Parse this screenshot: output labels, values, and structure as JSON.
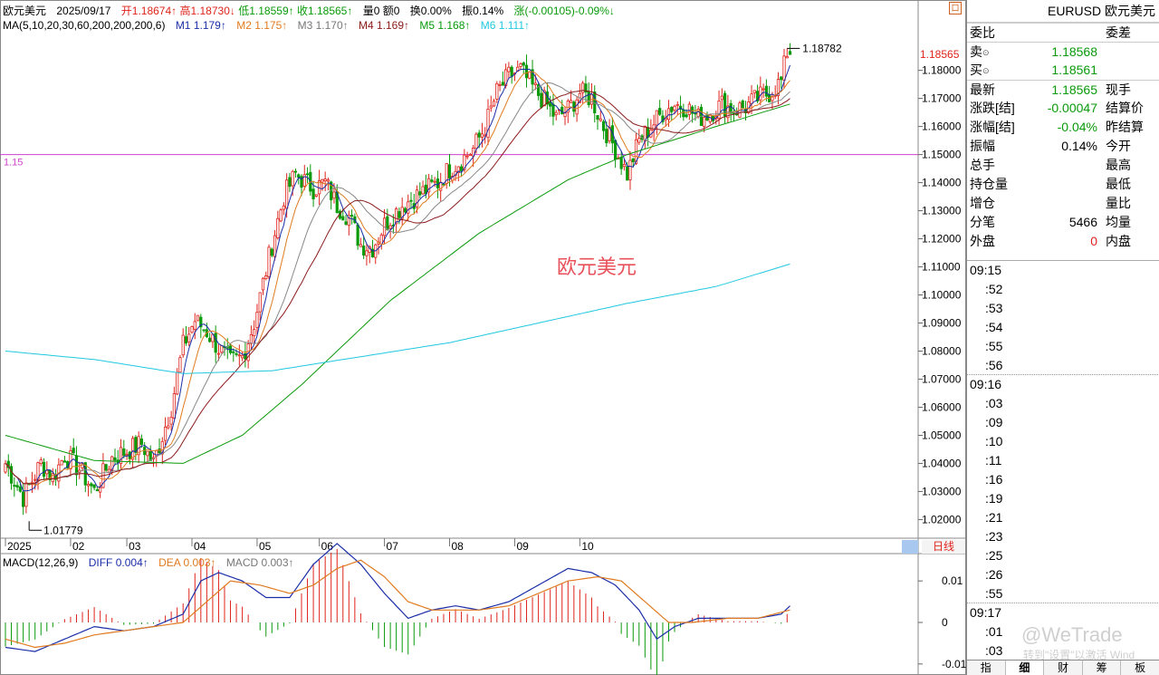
{
  "header": {
    "name": "欧元美元",
    "date": "2025/09/17",
    "open": "开1.18674↑",
    "high": "高1.18730↓",
    "low": "低1.18559↑",
    "close": "收1.18565↑",
    "volume": "量0",
    "amount": "额0",
    "turnover": "换0.00%",
    "amplitude": "振0.14%",
    "change": "涨(-0.00105)-0.09%↓"
  },
  "ma_legend": {
    "title": "MA(5,10,20,30,60,200,200,200,6)",
    "items": [
      {
        "text": "M1 1.179↑",
        "color": "#1a2ea8"
      },
      {
        "text": "M2 1.175↑",
        "color": "#e07b20"
      },
      {
        "text": "M3 1.170↑",
        "color": "#888888"
      },
      {
        "text": "M4 1.169↑",
        "color": "#8b1a1a"
      },
      {
        "text": "M5 1.168↑",
        "color": "#0a9a0a"
      },
      {
        "text": "M6 1.111↑",
        "color": "#20c8e0"
      }
    ]
  },
  "macd_legend": {
    "title": "MACD(12,26,9)",
    "diff": "DIFF 0.004↑",
    "dea": "DEA 0.003↑",
    "macd": "MACD 0.003↑"
  },
  "chart_data": {
    "type": "candlestick",
    "price_axis": {
      "range": [
        1.014,
        1.1915
      ],
      "ticks": [
        "1.18000",
        "1.17000",
        "1.16000",
        "1.15000",
        "1.14000",
        "1.13000",
        "1.12000",
        "1.11000",
        "1.10000",
        "1.09000",
        "1.08000",
        "1.07000",
        "1.06000",
        "1.05000",
        "1.04000",
        "1.03000",
        "1.02000"
      ],
      "current_price": "1.18565"
    },
    "time_axis": [
      "2025",
      "02",
      "03",
      "04",
      "05",
      "06",
      "07",
      "08",
      "09",
      "10"
    ],
    "annotations": {
      "high": "1.18782",
      "low": "1.01779",
      "hline_value": 1.15,
      "hline_label": "1.15",
      "watermark_label": "欧元美元"
    },
    "candle_anchors": [
      [
        0,
        1.04
      ],
      [
        6,
        1.028
      ],
      [
        12,
        1.04
      ],
      [
        16,
        1.035
      ],
      [
        20,
        1.043
      ],
      [
        25,
        1.038
      ],
      [
        30,
        1.03
      ],
      [
        36,
        1.042
      ],
      [
        42,
        1.045
      ],
      [
        46,
        1.047
      ],
      [
        50,
        1.04
      ],
      [
        56,
        1.06
      ],
      [
        60,
        1.082
      ],
      [
        64,
        1.091
      ],
      [
        68,
        1.087
      ],
      [
        72,
        1.081
      ],
      [
        76,
        1.076
      ],
      [
        80,
        1.078
      ],
      [
        84,
        1.09
      ],
      [
        90,
        1.118
      ],
      [
        94,
        1.135
      ],
      [
        98,
        1.143
      ],
      [
        104,
        1.138
      ],
      [
        108,
        1.14
      ],
      [
        112,
        1.132
      ],
      [
        116,
        1.128
      ],
      [
        120,
        1.118
      ],
      [
        124,
        1.117
      ],
      [
        128,
        1.125
      ],
      [
        134,
        1.132
      ],
      [
        140,
        1.136
      ],
      [
        146,
        1.14
      ],
      [
        150,
        1.145
      ],
      [
        154,
        1.148
      ],
      [
        158,
        1.152
      ],
      [
        162,
        1.16
      ],
      [
        166,
        1.172
      ],
      [
        170,
        1.178
      ],
      [
        174,
        1.18
      ],
      [
        178,
        1.174
      ],
      [
        182,
        1.169
      ],
      [
        186,
        1.163
      ],
      [
        190,
        1.166
      ],
      [
        194,
        1.172
      ],
      [
        198,
        1.17
      ],
      [
        202,
        1.16
      ],
      [
        206,
        1.152
      ],
      [
        210,
        1.143
      ],
      [
        214,
        1.155
      ],
      [
        218,
        1.16
      ],
      [
        222,
        1.165
      ],
      [
        226,
        1.168
      ],
      [
        230,
        1.167
      ],
      [
        234,
        1.163
      ],
      [
        238,
        1.165
      ],
      [
        242,
        1.168
      ],
      [
        246,
        1.166
      ],
      [
        250,
        1.167
      ],
      [
        254,
        1.17
      ],
      [
        258,
        1.172
      ],
      [
        262,
        1.176
      ],
      [
        264,
        1.18674
      ],
      [
        265,
        1.18565
      ]
    ],
    "ma_anchors": {
      "ma200": [
        [
          0,
          1.08
        ],
        [
          30,
          1.077
        ],
        [
          60,
          1.072
        ],
        [
          90,
          1.073
        ],
        [
          120,
          1.078
        ],
        [
          150,
          1.083
        ],
        [
          180,
          1.09
        ],
        [
          210,
          1.097
        ],
        [
          240,
          1.103
        ],
        [
          265,
          1.111
        ]
      ],
      "ma60": [
        [
          0,
          1.05
        ],
        [
          30,
          1.041
        ],
        [
          60,
          1.04
        ],
        [
          80,
          1.05
        ],
        [
          100,
          1.068
        ],
        [
          130,
          1.098
        ],
        [
          160,
          1.122
        ],
        [
          190,
          1.141
        ],
        [
          210,
          1.15
        ],
        [
          240,
          1.16
        ],
        [
          265,
          1.168
        ]
      ]
    },
    "macd_axis": {
      "ticks": [
        "0.01",
        "0",
        "-0.01"
      ],
      "range": [
        -0.012,
        0.012
      ]
    },
    "macd_diff_anchors": [
      [
        0,
        -0.006
      ],
      [
        10,
        -0.007
      ],
      [
        20,
        -0.004
      ],
      [
        30,
        -0.001
      ],
      [
        40,
        -0.002
      ],
      [
        50,
        -0.001
      ],
      [
        60,
        0.002
      ],
      [
        66,
        0.01
      ],
      [
        72,
        0.012
      ],
      [
        80,
        0.01
      ],
      [
        88,
        0.006
      ],
      [
        96,
        0.006
      ],
      [
        104,
        0.014
      ],
      [
        112,
        0.019
      ],
      [
        120,
        0.014
      ],
      [
        128,
        0.007
      ],
      [
        136,
        0.001
      ],
      [
        144,
        0.003
      ],
      [
        152,
        0.004
      ],
      [
        160,
        0.003
      ],
      [
        170,
        0.005
      ],
      [
        180,
        0.009
      ],
      [
        190,
        0.013
      ],
      [
        198,
        0.012
      ],
      [
        206,
        0.009
      ],
      [
        214,
        0.003
      ],
      [
        220,
        -0.004
      ],
      [
        226,
        -0.001
      ],
      [
        234,
        0.001
      ],
      [
        244,
        0.001
      ],
      [
        254,
        0.001
      ],
      [
        262,
        0.002
      ],
      [
        265,
        0.004
      ]
    ],
    "macd_dea_anchors": [
      [
        0,
        -0.004
      ],
      [
        10,
        -0.006
      ],
      [
        20,
        -0.005
      ],
      [
        30,
        -0.003
      ],
      [
        40,
        -0.002
      ],
      [
        50,
        -0.001
      ],
      [
        60,
        0.0
      ],
      [
        68,
        0.005
      ],
      [
        76,
        0.01
      ],
      [
        86,
        0.009
      ],
      [
        96,
        0.007
      ],
      [
        104,
        0.009
      ],
      [
        112,
        0.013
      ],
      [
        120,
        0.015
      ],
      [
        128,
        0.011
      ],
      [
        136,
        0.005
      ],
      [
        144,
        0.003
      ],
      [
        152,
        0.003
      ],
      [
        160,
        0.003
      ],
      [
        170,
        0.004
      ],
      [
        180,
        0.007
      ],
      [
        190,
        0.01
      ],
      [
        200,
        0.011
      ],
      [
        208,
        0.01
      ],
      [
        216,
        0.005
      ],
      [
        224,
        0.0
      ],
      [
        232,
        0.0
      ],
      [
        244,
        0.001
      ],
      [
        254,
        0.001
      ],
      [
        265,
        0.003
      ]
    ]
  },
  "panel": {
    "title": "EURUSD 欧元美元",
    "weibi_label": "委比",
    "weicha_label": "委差",
    "sell_label": "卖",
    "sell_value": "1.18568",
    "buy_label": "买",
    "buy_value": "1.18561",
    "latest_label": "最新",
    "latest_value": "1.18565",
    "xianshou_label": "现手",
    "zhangdie_label": "涨跌[结]",
    "zhangdie_value": "-0.00047",
    "jiesuan_label": "结算价",
    "zhangfu_label": "涨幅[结]",
    "zhangfu_value": "-0.04%",
    "zuojiesuan_label": "昨结算",
    "zhenfu_label": "振幅",
    "zhenfu_value": "0.14%",
    "jinkai_label": "今开",
    "zongshou_label": "总手",
    "zuigao_label": "最高",
    "chicang_label": "持仓量",
    "zuidi_label": "最低",
    "zengcang_label": "增仓",
    "liangbi_label": "量比",
    "fenbi_label": "分笔",
    "fenbi_value": "5466",
    "junliang_label": "均量",
    "waipan_label": "外盘",
    "waipan_value": "0",
    "neipan_label": "内盘",
    "ticks": [
      "09:15",
      ":52",
      ":53",
      ":54",
      ":55",
      ":56",
      "09:16",
      ":03",
      ":09",
      ":10",
      ":11",
      ":16",
      ":19",
      ":21",
      ":23",
      ":25",
      ":26",
      ":55",
      "09:17",
      ":01",
      ":03"
    ],
    "tabs": [
      "指",
      "细",
      "财",
      "筹",
      "板"
    ]
  },
  "period_label": "日线",
  "corner_icon_label": "口",
  "watermark_text": "@WeTrade",
  "activate_text": "转到\"设置\"以激活 Wind"
}
